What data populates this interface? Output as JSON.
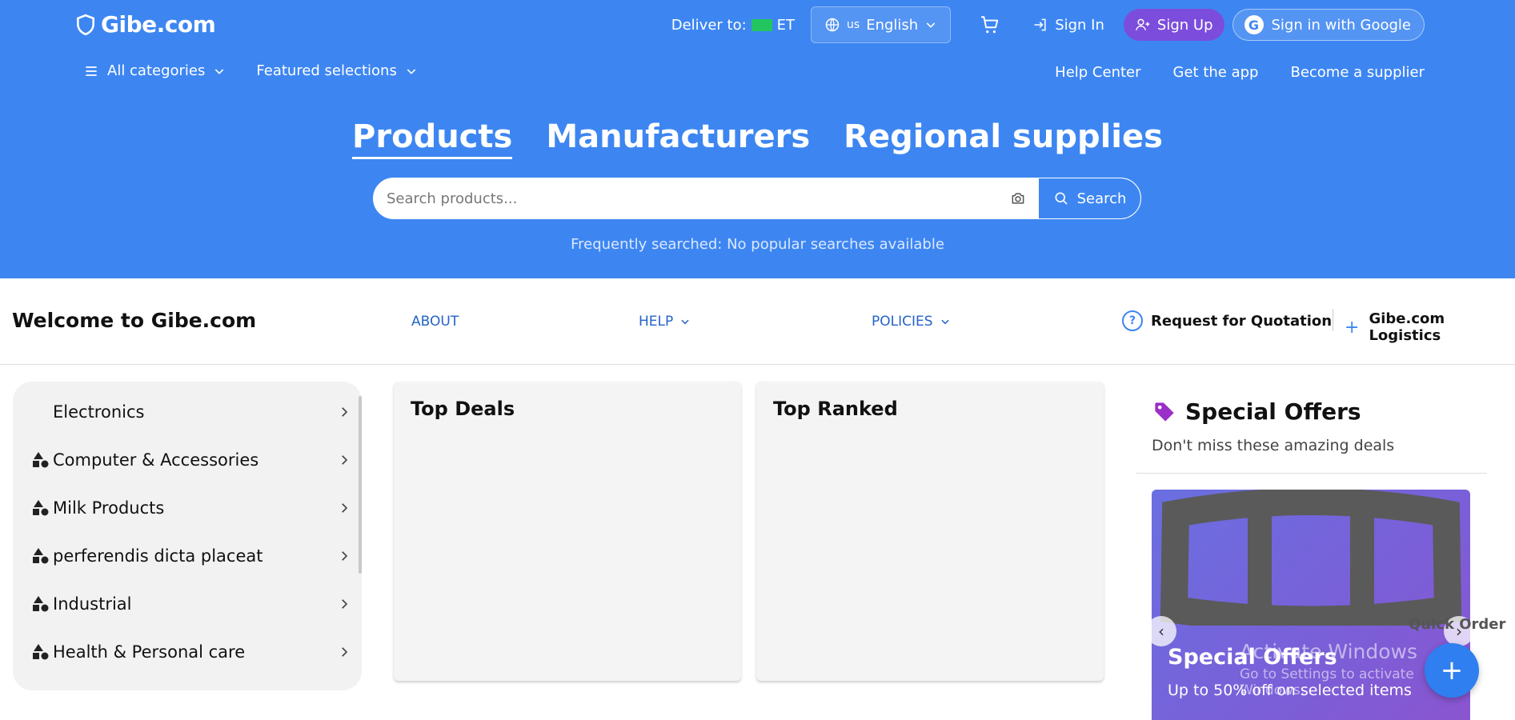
{
  "brand": {
    "name": "Gibe.com",
    "accent": "#3d86f2",
    "logo_icon": "shield-icon"
  },
  "topbar": {
    "deliver_label": "Deliver to:",
    "deliver_country": "ET",
    "language_prefix": "us",
    "language": "English",
    "cart_icon": "cart-icon",
    "signin": "Sign In",
    "signup": "Sign Up",
    "google": "Sign in with Google"
  },
  "nav": {
    "all_categories": "All categories",
    "featured": "Featured selections",
    "help_center": "Help Center",
    "get_app": "Get the app",
    "become_supplier": "Become a supplier"
  },
  "tabs": [
    {
      "label": "Products",
      "active": true
    },
    {
      "label": "Manufacturers",
      "active": false
    },
    {
      "label": "Regional supplies",
      "active": false
    }
  ],
  "search": {
    "placeholder": "Search products...",
    "button": "Search",
    "frequently_label": "Frequently searched:",
    "frequently_value": "No popular searches available"
  },
  "subnav": {
    "welcome": "Welcome to Gibe.com",
    "about": "ABOUT",
    "help": "HELP",
    "policies": "POLICIES",
    "rfq": "Request for Quotation",
    "logistics": "Gibe.com Logistics"
  },
  "categories": [
    {
      "label": "Electronics",
      "icon": ""
    },
    {
      "label": "Computer & Accessories",
      "icon": "shapes-icon"
    },
    {
      "label": "Milk Products",
      "icon": "shapes-icon"
    },
    {
      "label": "perferendis dicta placeat",
      "icon": "shapes-icon"
    },
    {
      "label": "Industrial",
      "icon": "shapes-icon"
    },
    {
      "label": "Health & Personal care",
      "icon": "shapes-icon"
    }
  ],
  "panels": {
    "top_deals": "Top Deals",
    "top_ranked": "Top Ranked"
  },
  "offers": {
    "title": "Special Offers",
    "subtitle": "Don't miss these amazing deals",
    "banner_title": "Special Offers",
    "banner_text": "Up to 50% off on selected items",
    "tag_color": "#9b2fc9"
  },
  "quick_order": "Quick Order",
  "watermark": {
    "line1": "Activate Windows",
    "line2": "Go to Settings to activate Windows."
  }
}
